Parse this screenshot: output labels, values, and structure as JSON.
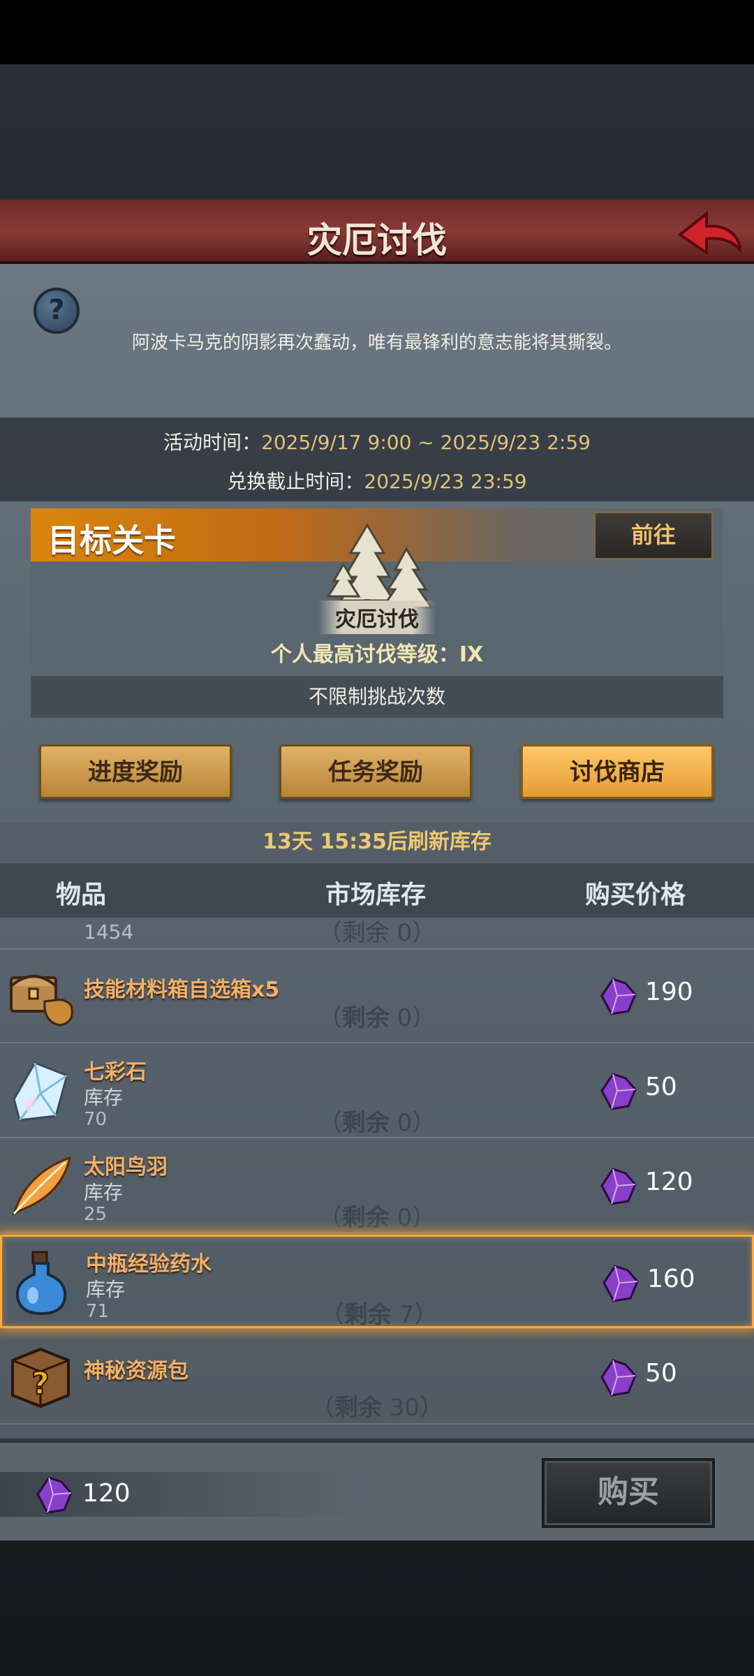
{
  "header": {
    "title": "灾厄讨伐"
  },
  "intro": {
    "help_icon": "?",
    "description": "阿波卡马克的阴影再次蠢动，唯有最锋利的意志能将其撕裂。"
  },
  "times": {
    "activity_label": "活动时间：",
    "activity_value": "2025/9/17 9:00 ~ 2025/9/23 2:59",
    "exchange_label": "兑换截止时间：",
    "exchange_value": "2025/9/23 23:59"
  },
  "target": {
    "title": "目标关卡",
    "go_label": "前往",
    "stage_name": "灾厄讨伐",
    "best_level": "个人最高讨伐等级：IX",
    "challenge_limit": "不限制挑战次数"
  },
  "tabs": [
    {
      "label": "进度奖励",
      "active": false
    },
    {
      "label": "任务奖励",
      "active": false
    },
    {
      "label": "讨伐商店",
      "active": true
    }
  ],
  "refresh_text": "13天 15:35后刷新库存",
  "columns": {
    "item": "物品",
    "stock": "市场库存",
    "price": "购买价格"
  },
  "partial_row": {
    "stock_value": "1454",
    "remain": "（剩余 0）"
  },
  "shop_items": [
    {
      "name": "技能材料箱自选箱x5",
      "stock_label": "",
      "stock_value": "",
      "remain_label": "剩余",
      "remain_count": "0",
      "price": "190",
      "icon": "chest-icon"
    },
    {
      "name": "七彩石",
      "stock_label": "库存",
      "stock_value": "70",
      "remain_label": "剩余",
      "remain_count": "0",
      "price": "50",
      "icon": "crystal-icon"
    },
    {
      "name": "太阳鸟羽",
      "stock_label": "库存",
      "stock_value": "25",
      "remain_label": "剩余",
      "remain_count": "0",
      "price": "120",
      "icon": "feather-icon"
    },
    {
      "name": "中瓶经验药水",
      "stock_label": "库存",
      "stock_value": "71",
      "remain_label": "剩余",
      "remain_count": "7",
      "price": "160",
      "icon": "potion-icon",
      "selected": true
    },
    {
      "name": "神秘资源包",
      "stock_label": "",
      "stock_value": "",
      "remain_label": "剩余",
      "remain_count": "30",
      "price": "50",
      "icon": "mystery-box-icon"
    }
  ],
  "footer": {
    "balance": "120",
    "buy_label": "购买"
  },
  "colors": {
    "accent_orange": "#ffaa3a",
    "gem_purple": "#8a3fc8",
    "title_red": "#8a3a36"
  }
}
